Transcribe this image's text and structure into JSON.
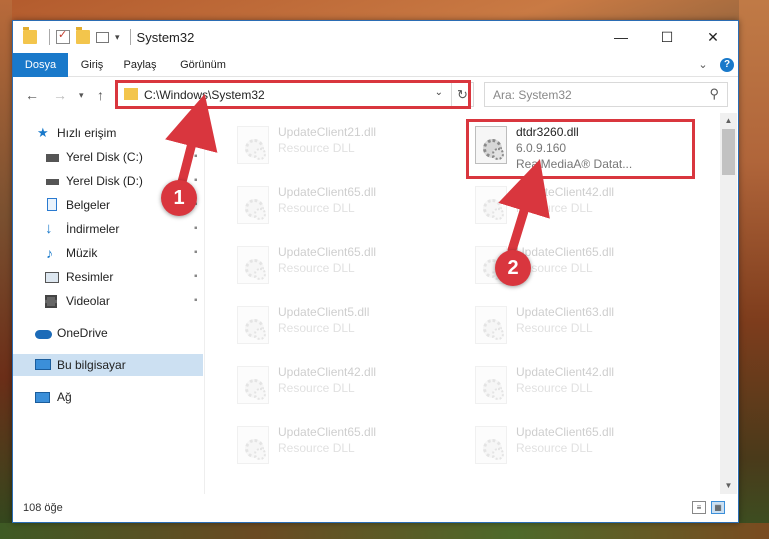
{
  "window": {
    "title": "System32",
    "minimize_glyph": "—",
    "maximize_glyph": "☐",
    "close_glyph": "✕"
  },
  "ribbon": {
    "tabs": [
      "Dosya",
      "Giriş",
      "Paylaş",
      "Görünüm"
    ],
    "active_tab": "Dosya",
    "collapse_glyph": "⌄",
    "help_glyph": "?"
  },
  "address": {
    "path": "C:\\Windows\\System32",
    "dropdown_glyph": "⌄",
    "refresh_glyph": "↻"
  },
  "search": {
    "placeholder": "Ara: System32",
    "icon": "search-icon"
  },
  "sidebar": {
    "items": [
      {
        "label": "Hızlı erişim",
        "icon": "star-icon"
      },
      {
        "label": "Yerel Disk (C:)",
        "icon": "drive-icon",
        "pinned": true
      },
      {
        "label": "Yerel Disk (D:)",
        "icon": "drive-icon",
        "pinned": true
      },
      {
        "label": "Belgeler",
        "icon": "documents-icon",
        "pinned": true
      },
      {
        "label": "İndirmeler",
        "icon": "download-icon",
        "pinned": true
      },
      {
        "label": "Müzik",
        "icon": "music-icon",
        "pinned": true
      },
      {
        "label": "Resimler",
        "icon": "pictures-icon",
        "pinned": true
      },
      {
        "label": "Videolar",
        "icon": "videos-icon",
        "pinned": true
      },
      {
        "label": "OneDrive",
        "icon": "cloud-icon"
      },
      {
        "label": "Bu bilgisayar",
        "icon": "computer-icon",
        "selected": true
      },
      {
        "label": "Ağ",
        "icon": "network-icon"
      }
    ],
    "pin_glyph": "📌"
  },
  "files": {
    "highlighted": {
      "name": "dtdr3260.dll",
      "version": "6.0.9.160",
      "description": "RealMediaA® Datat..."
    },
    "left_column": [
      {
        "name": "UpdateClient21.dll",
        "type": "Resource DLL"
      },
      {
        "name": "UpdateClient65.dll",
        "type": "Resource DLL"
      },
      {
        "name": "UpdateClient65.dll",
        "type": "Resource DLL"
      },
      {
        "name": "UpdateClient5.dll",
        "type": "Resource DLL"
      },
      {
        "name": "UpdateClient42.dll",
        "type": "Resource DLL"
      },
      {
        "name": "UpdateClient65.dll",
        "type": "Resource DLL"
      }
    ],
    "right_column": [
      {
        "name": "UpdateClient42.dll",
        "type": "Resource DLL"
      },
      {
        "name": "UpdateClient65.dll",
        "type": "Resource DLL"
      },
      {
        "name": "UpdateClient63.dll",
        "type": "Resource DLL"
      },
      {
        "name": "UpdateClient42.dll",
        "type": "Resource DLL"
      },
      {
        "name": "UpdateClient65.dll",
        "type": "Resource DLL"
      }
    ]
  },
  "status": {
    "item_count": "108 öğe"
  },
  "annotations": {
    "markers": [
      "1",
      "2"
    ],
    "color": "#d9363e"
  },
  "colors": {
    "accent": "#1979ca",
    "selected_bg": "#cce0f2",
    "highlight": "#d9363e"
  }
}
